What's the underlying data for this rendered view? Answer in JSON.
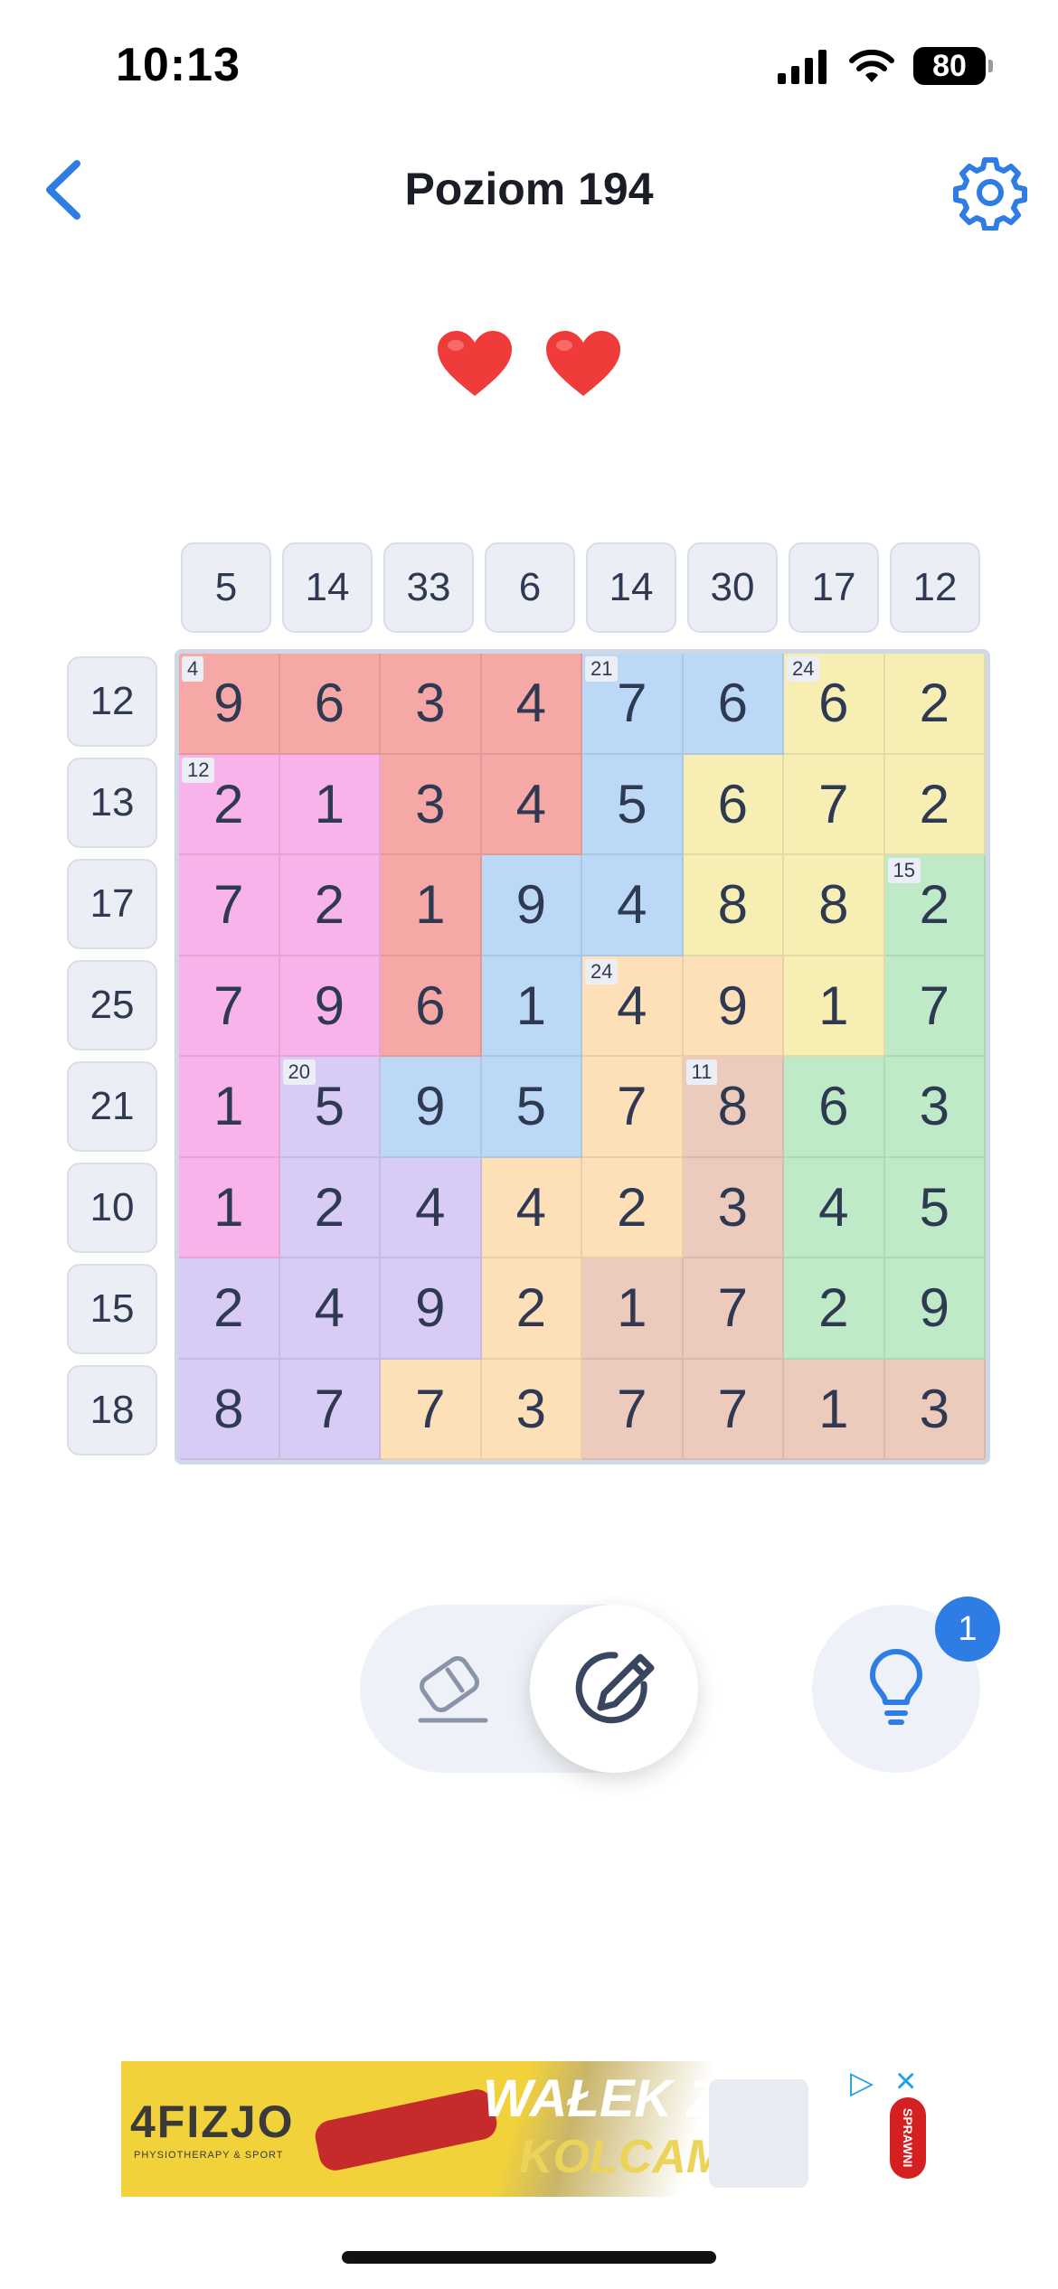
{
  "status_bar": {
    "time": "10:13",
    "battery": "80"
  },
  "header": {
    "title": "Poziom 194"
  },
  "lives": {
    "count": 2
  },
  "column_sums": [
    "5",
    "14",
    "33",
    "6",
    "14",
    "30",
    "17",
    "12"
  ],
  "row_sums": [
    "12",
    "13",
    "17",
    "25",
    "21",
    "10",
    "15",
    "18"
  ],
  "colors": {
    "red": "#f6a8a6",
    "pink": "#f7b3ea",
    "blue": "#bcd8f7",
    "yellow": "#f6eeb3",
    "green": "#bfeac7",
    "orange": "#fde0b8",
    "violet": "#d8cbf5",
    "brown": "#eccbbd",
    "accent": "#2e7de5"
  },
  "grid": [
    [
      {
        "v": "9",
        "c": "red",
        "l": "4"
      },
      {
        "v": "6",
        "c": "red"
      },
      {
        "v": "3",
        "c": "red"
      },
      {
        "v": "4",
        "c": "red"
      },
      {
        "v": "7",
        "c": "blue",
        "l": "21"
      },
      {
        "v": "6",
        "c": "blue"
      },
      {
        "v": "6",
        "c": "yellow",
        "l": "24"
      },
      {
        "v": "2",
        "c": "yellow"
      }
    ],
    [
      {
        "v": "2",
        "c": "pink",
        "l": "12"
      },
      {
        "v": "1",
        "c": "pink"
      },
      {
        "v": "3",
        "c": "red"
      },
      {
        "v": "4",
        "c": "red"
      },
      {
        "v": "5",
        "c": "blue"
      },
      {
        "v": "6",
        "c": "yellow"
      },
      {
        "v": "7",
        "c": "yellow"
      },
      {
        "v": "2",
        "c": "yellow"
      }
    ],
    [
      {
        "v": "7",
        "c": "pink"
      },
      {
        "v": "2",
        "c": "pink"
      },
      {
        "v": "1",
        "c": "red"
      },
      {
        "v": "9",
        "c": "blue"
      },
      {
        "v": "4",
        "c": "blue"
      },
      {
        "v": "8",
        "c": "yellow"
      },
      {
        "v": "8",
        "c": "yellow"
      },
      {
        "v": "2",
        "c": "green",
        "l": "15"
      }
    ],
    [
      {
        "v": "7",
        "c": "pink"
      },
      {
        "v": "9",
        "c": "pink"
      },
      {
        "v": "6",
        "c": "red"
      },
      {
        "v": "1",
        "c": "blue"
      },
      {
        "v": "4",
        "c": "orange",
        "l": "24"
      },
      {
        "v": "9",
        "c": "orange"
      },
      {
        "v": "1",
        "c": "yellow"
      },
      {
        "v": "7",
        "c": "green"
      }
    ],
    [
      {
        "v": "1",
        "c": "pink"
      },
      {
        "v": "5",
        "c": "violet",
        "l": "20"
      },
      {
        "v": "9",
        "c": "blue"
      },
      {
        "v": "5",
        "c": "blue"
      },
      {
        "v": "7",
        "c": "orange"
      },
      {
        "v": "8",
        "c": "brown",
        "l": "11"
      },
      {
        "v": "6",
        "c": "green"
      },
      {
        "v": "3",
        "c": "green"
      }
    ],
    [
      {
        "v": "1",
        "c": "pink"
      },
      {
        "v": "2",
        "c": "violet"
      },
      {
        "v": "4",
        "c": "violet"
      },
      {
        "v": "4",
        "c": "orange"
      },
      {
        "v": "2",
        "c": "orange"
      },
      {
        "v": "3",
        "c": "brown"
      },
      {
        "v": "4",
        "c": "green"
      },
      {
        "v": "5",
        "c": "green"
      }
    ],
    [
      {
        "v": "2",
        "c": "violet"
      },
      {
        "v": "4",
        "c": "violet"
      },
      {
        "v": "9",
        "c": "violet"
      },
      {
        "v": "2",
        "c": "orange"
      },
      {
        "v": "1",
        "c": "brown"
      },
      {
        "v": "7",
        "c": "brown"
      },
      {
        "v": "2",
        "c": "green"
      },
      {
        "v": "9",
        "c": "green"
      }
    ],
    [
      {
        "v": "8",
        "c": "violet"
      },
      {
        "v": "7",
        "c": "violet"
      },
      {
        "v": "7",
        "c": "orange"
      },
      {
        "v": "3",
        "c": "orange"
      },
      {
        "v": "7",
        "c": "brown"
      },
      {
        "v": "7",
        "c": "brown"
      },
      {
        "v": "1",
        "c": "brown"
      },
      {
        "v": "3",
        "c": "brown"
      }
    ]
  ],
  "tools": {
    "hint_count": "1"
  },
  "ad": {
    "brand": "4FIZJO",
    "brand_sub": "PHYSIOTHERAPY & SPORT",
    "line1": "WAŁEK Z",
    "line2": "KOLCAMI",
    "badge": "SPRAWNI"
  }
}
